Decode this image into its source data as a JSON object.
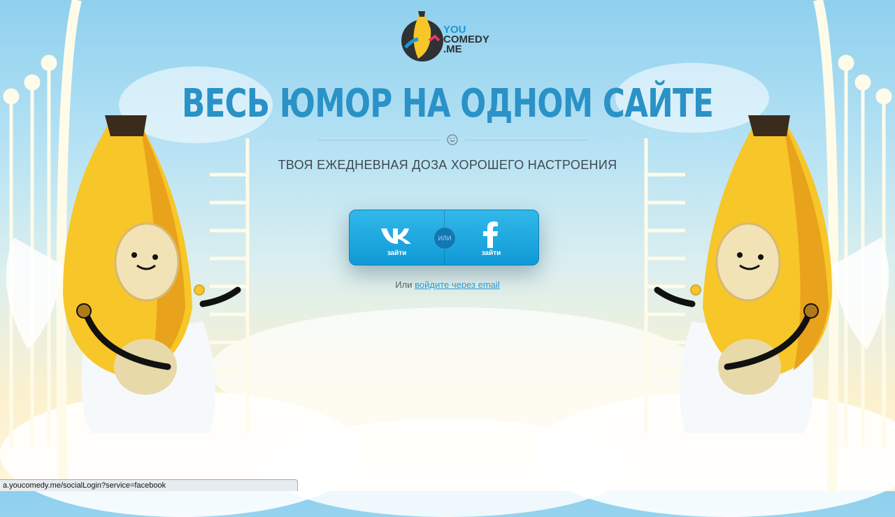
{
  "logo": {
    "line1": "YOU",
    "line2": "COMEDY",
    "line3": ".ME"
  },
  "headline": "ВЕСЬ ЮМОР НА ОДНОМ САЙТЕ",
  "subtitle": "ТВОЯ ЕЖЕДНЕВНАЯ ДОЗА ХОРОШЕГО НАСТРОЕНИЯ",
  "login": {
    "vk_label": "зайти",
    "or_label": "ИЛИ",
    "fb_label": "зайти"
  },
  "email_login": {
    "prefix": "Или",
    "link": "войдите через email"
  },
  "status_bar": "a.youcomedy.me/socialLogin?service=facebook",
  "colors": {
    "accent": "#2a92c6",
    "button": "#1aa6de",
    "banana": "#f7c628"
  }
}
